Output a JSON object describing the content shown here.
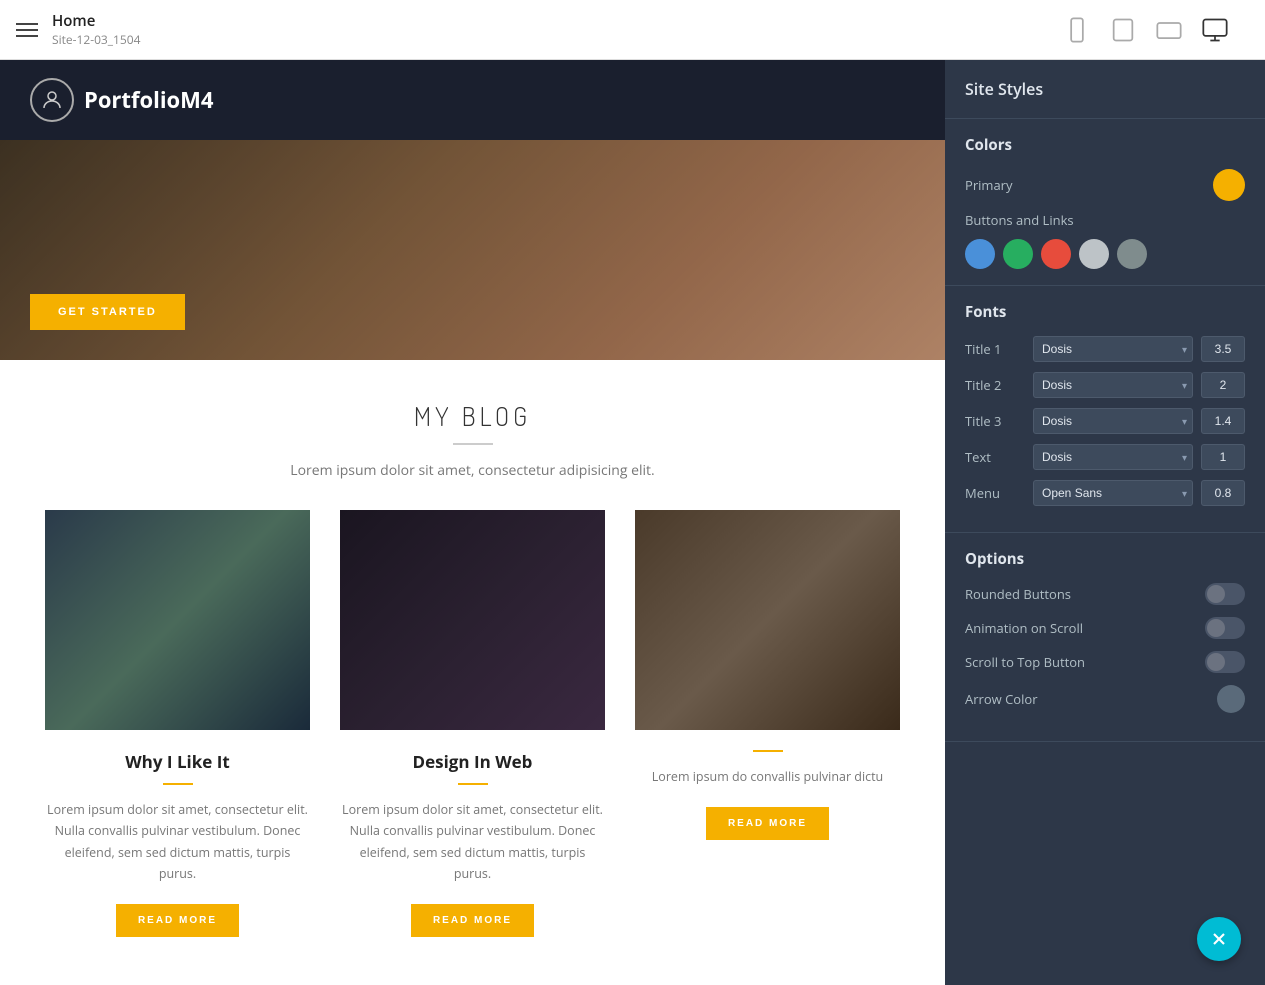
{
  "topbar": {
    "hamburger_label": "menu",
    "page_name": "Home",
    "site_name": "Site-12-03_1504"
  },
  "devices": [
    {
      "id": "mobile",
      "label": "Mobile"
    },
    {
      "id": "tablet",
      "label": "Tablet"
    },
    {
      "id": "tablet-landscape",
      "label": "Tablet Landscape"
    },
    {
      "id": "desktop",
      "label": "Desktop"
    }
  ],
  "site": {
    "logo_text": "PortfolioM4",
    "hero_button": "GET STARTED",
    "blog_title": "MY BLOG",
    "blog_subtitle": "Lorem ipsum dolor sit amet, consectetur adipisicing elit.",
    "cards": [
      {
        "title": "Why I Like It",
        "text": "Lorem ipsum dolor sit amet, consectetur elit. Nulla convallis pulvinar vestibulum. Donec eleifend, sem sed dictum mattis, turpis purus.",
        "read_more": "READ MORE"
      },
      {
        "title": "Design In Web",
        "text": "Lorem ipsum dolor sit amet, consectetur elit. Nulla convallis pulvinar vestibulum. Donec eleifend, sem sed dictum mattis, turpis purus.",
        "read_more": "READ MORE"
      },
      {
        "title": "",
        "text": "Lorem ipsum do convallis pulvinar dictu",
        "read_more": "READ MORE"
      }
    ]
  },
  "panel": {
    "title": "Site Styles",
    "sections": {
      "colors": {
        "label": "Colors",
        "primary_label": "Primary",
        "primary_color": "#f5b000",
        "buttons_links_label": "Buttons and Links",
        "swatches": [
          "#4a90d9",
          "#27ae60",
          "#e74c3c",
          "#bdc3c7",
          "#7f8c8d"
        ]
      },
      "fonts": {
        "label": "Fonts",
        "rows": [
          {
            "label": "Title 1",
            "font": "Dosis",
            "size": "3.5"
          },
          {
            "label": "Title 2",
            "font": "Dosis",
            "size": "2"
          },
          {
            "label": "Title 3",
            "font": "Dosis",
            "size": "1.4"
          },
          {
            "label": "Text",
            "font": "Dosis",
            "size": "1"
          },
          {
            "label": "Menu",
            "font": "Open Sans",
            "size": "0.8"
          }
        ]
      },
      "options": {
        "label": "Options",
        "items": [
          {
            "label": "Rounded Buttons",
            "enabled": false
          },
          {
            "label": "Animation on Scroll",
            "enabled": false
          },
          {
            "label": "Scroll to Top Button",
            "enabled": false
          },
          {
            "label": "Arrow Color",
            "type": "color"
          }
        ]
      }
    }
  }
}
